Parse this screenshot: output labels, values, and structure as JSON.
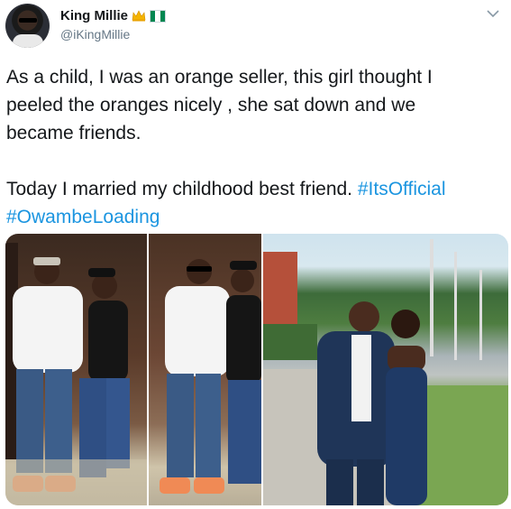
{
  "author": {
    "name": "King Millie",
    "handle": "@iKingMillie",
    "badges": [
      "crown-emoji",
      "nigeria-flag-emoji"
    ]
  },
  "tweet": {
    "line1": "As a child, I was an orange seller, this girl thought I",
    "line2": "peeled the oranges nicely , she sat down and we",
    "line3": "became friends.",
    "line4_text": "Today I married my childhood best friend. ",
    "hashtag1": "#ItsOfficial",
    "hashtag2": "#OwambeLoading"
  },
  "media": {
    "photos": [
      "couple-photo-1",
      "couple-photo-2",
      "couple-photo-3"
    ]
  },
  "colors": {
    "link": "#1b95e0",
    "text": "#14171a",
    "secondary": "#657786"
  }
}
